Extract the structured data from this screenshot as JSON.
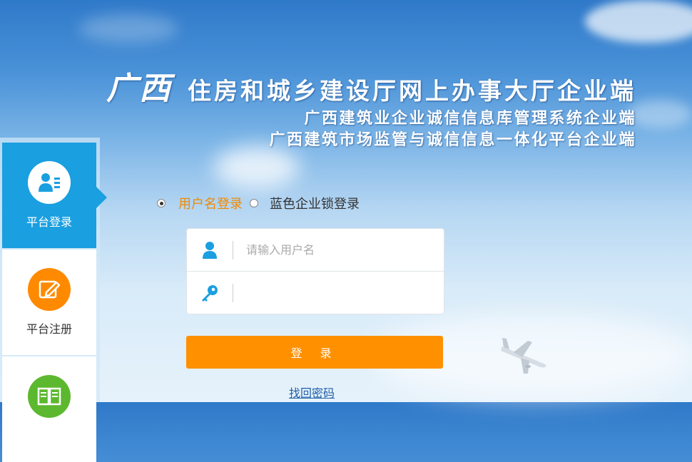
{
  "header": {
    "brand": "广西",
    "title": "住房和城乡建设厅网上办事大厅企业端",
    "subtitle1": "广西建筑业企业诚信信息库管理系统企业端",
    "subtitle2": "广西建筑市场监管与诚信信息一体化平台企业端"
  },
  "sidebar": {
    "items": [
      {
        "label": "平台登录",
        "icon": "user-card-icon",
        "color": "#1a9fe0",
        "active": true
      },
      {
        "label": "平台注册",
        "icon": "edit-icon",
        "color": "#ff8a00",
        "active": false
      },
      {
        "label": "",
        "icon": "book-icon",
        "color": "#5cb82e",
        "active": false
      }
    ]
  },
  "login": {
    "option_username": "用户名登录",
    "option_usbkey": "蓝色企业锁登录",
    "selected": "username",
    "username_placeholder": "请输入用户名",
    "password_value": "",
    "submit_label": "登 录",
    "forgot_label": "找回密码"
  },
  "colors": {
    "accent": "#1a9fe0",
    "button": "#ff9000",
    "selected_option": "#f08a00"
  }
}
